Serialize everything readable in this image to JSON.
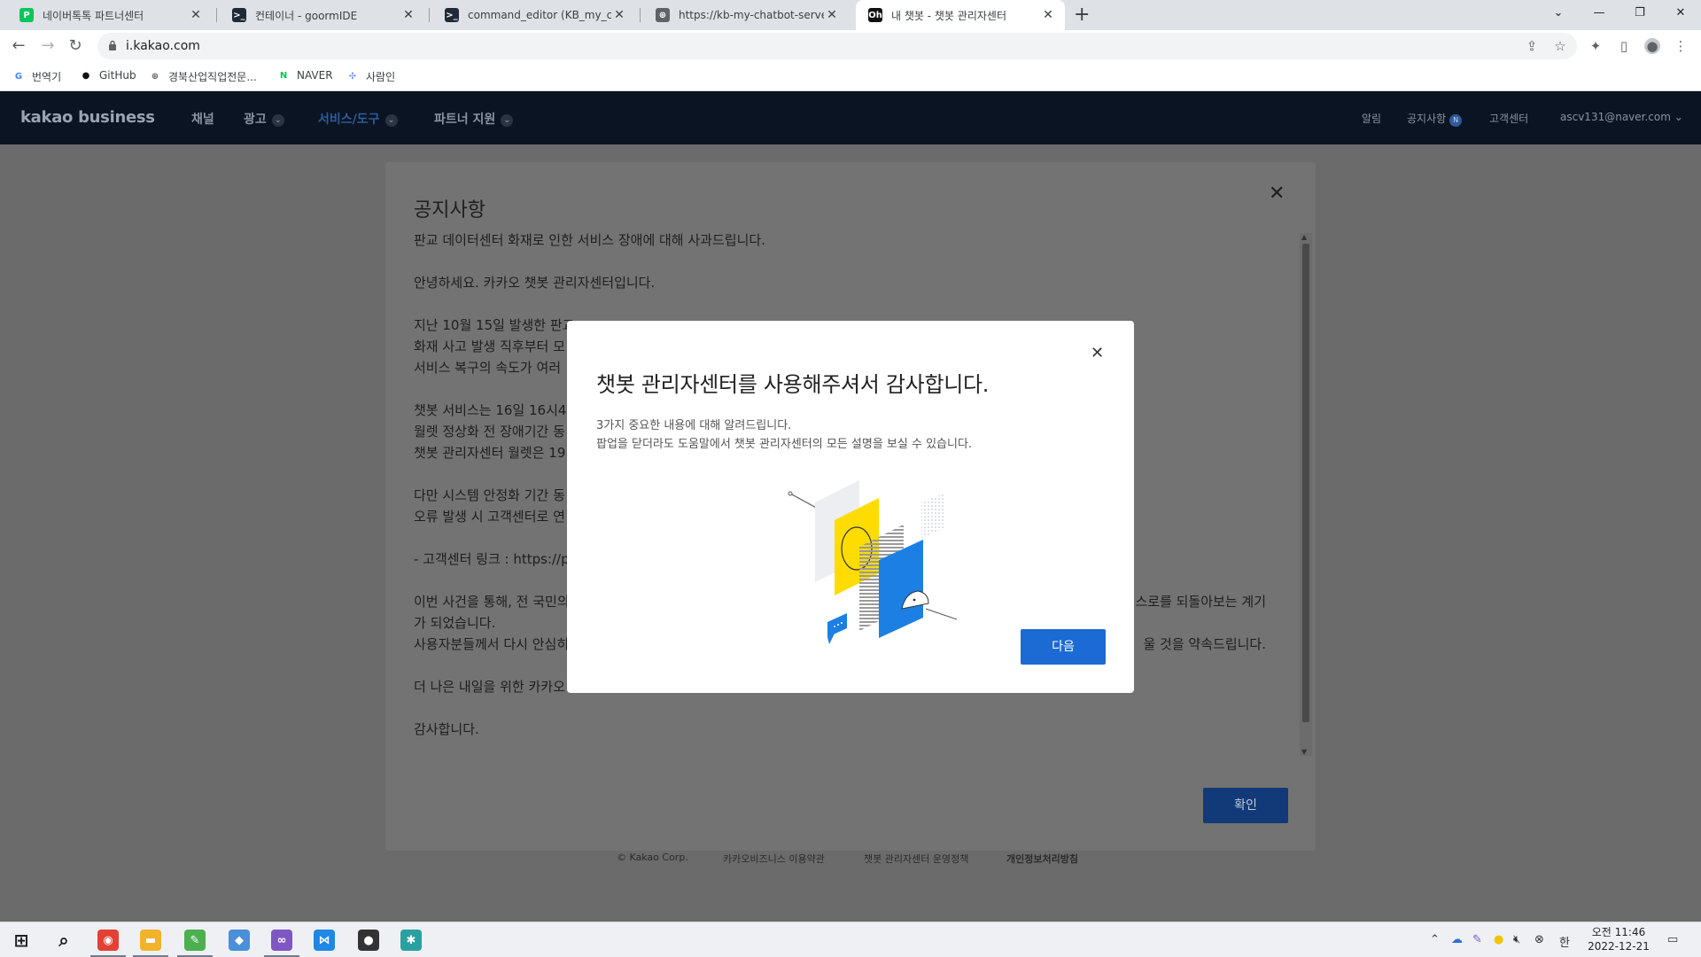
{
  "browser": {
    "tabs": [
      {
        "title": "네이버톡톡 파트너센터",
        "icon": "naver-talktalk-icon",
        "color": "#03c75a",
        "glyph": "P"
      },
      {
        "title": "컨테이너 - goormIDE",
        "icon": "terminal-icon",
        "color": "#1f2937",
        "glyph": ">_"
      },
      {
        "title": "command_editor (KB_my_chatbot...",
        "icon": "terminal-icon",
        "color": "#1f2937",
        "glyph": ">_"
      },
      {
        "title": "https://kb-my-chatbot-server-gu...",
        "icon": "globe-icon",
        "color": "#5f6368",
        "glyph": "⊕"
      },
      {
        "title": "내 챗봇 - 챗봇 관리자센터",
        "icon": "chatbot-icon",
        "color": "#111111",
        "glyph": "Oh"
      }
    ],
    "new_tab": "+",
    "window_controls": {
      "tab_search": "⌄",
      "minimize": "—",
      "restore": "❐",
      "close": "✕"
    },
    "url": "i.kakao.com",
    "bookmarks": [
      {
        "label": "번역기",
        "icon": "google-icon",
        "glyph": "G",
        "color": "#4285f4"
      },
      {
        "label": "GitHub",
        "icon": "github-icon",
        "glyph": "●",
        "color": "#111111"
      },
      {
        "label": "경북산업직업전문...",
        "icon": "globe-icon",
        "glyph": "⊕",
        "color": "#5f6368"
      },
      {
        "label": "NAVER",
        "icon": "naver-icon",
        "glyph": "N",
        "color": "#03c75a"
      },
      {
        "label": "사람인",
        "icon": "saramin-icon",
        "glyph": "✣",
        "color": "#6b8cff"
      }
    ]
  },
  "site": {
    "logo": "kakao business",
    "nav": [
      {
        "label": "채널",
        "has_menu": false,
        "active": false
      },
      {
        "label": "광고",
        "has_menu": true,
        "active": false
      },
      {
        "label": "서비스/도구",
        "has_menu": true,
        "active": true
      },
      {
        "label": "파트너 지원",
        "has_menu": true,
        "active": false
      }
    ],
    "util": {
      "alarm": "알림",
      "notice": "공지사항",
      "notice_badge": "N",
      "support": "고객센터",
      "account": "ascv131@naver.com ⌄"
    },
    "footer": {
      "copyright": "© Kakao Corp.",
      "terms": "카카오비즈니스 이용약관",
      "policy": "챗봇 관리자센터 운영정책",
      "privacy": "개인정보처리방침"
    }
  },
  "notice": {
    "title": "공지사항",
    "lines": [
      "판교 데이터센터 화재로 인한 서비스 장애에 대해 사과드립니다.",
      "",
      "안녕하세요. 카카오 챗봇 관리자센터입니다.",
      "",
      "지난 10월 15일 발생한 판교",
      "화재 사고 발생 직후부터 모",
      "서비스 복구의 속도가 여러",
      "",
      "챗봇 서비스는 16일 16시4",
      "월렛 정상화 전 장애기간 동",
      "챗봇 관리자센터 월렛은 19",
      "",
      "다만 시스템 안정화 기간 동",
      "오류 발생 시 고객센터로 연",
      "",
      "- 고객센터 링크 : https://p",
      "",
      "이번 사건을 통해, 전 국민의",
      "가 되었습니다.",
      "사용자분들께서 다시 안심히",
      "",
      "더 나은 내일을 위한 카카오",
      "",
      "감사합니다."
    ],
    "right_fragments": [
      {
        "line": 17,
        "text": "스로를 되돌아보는 계기"
      },
      {
        "line": 19,
        "text": "울 것을 약속드립니다."
      }
    ],
    "ok_label": "확인"
  },
  "dialog": {
    "title": "챗봇 관리자센터를 사용해주셔서 감사합니다.",
    "desc_1": "3가지 중요한 내용에 대해 알려드립니다.",
    "desc_2": "팝업을 닫더라도 도움말에서 챗봇 관리자센터의 모든 설명을 보실 수 있습니다.",
    "next_label": "다음",
    "colors": {
      "yellow": "#fedc00",
      "blue": "#1c7fe3",
      "gray": "#eceef2"
    }
  },
  "taskbar": {
    "apps": [
      {
        "name": "start-button",
        "glyph": "⊞",
        "color": "#1f1f1f",
        "open": false
      },
      {
        "name": "search-icon",
        "glyph": "⌕",
        "color": "#1f1f1f",
        "open": false
      },
      {
        "name": "chrome-icon",
        "glyph": "◉",
        "color": "#e34133",
        "open": true
      },
      {
        "name": "file-explorer-icon",
        "glyph": "▬",
        "color": "#f2b32a",
        "open": true
      },
      {
        "name": "notepad-icon",
        "glyph": "✎",
        "color": "#4caf50",
        "open": true
      },
      {
        "name": "app-icon",
        "glyph": "◆",
        "color": "#4a8fd8",
        "open": false
      },
      {
        "name": "visual-studio-icon",
        "glyph": "∞",
        "color": "#7e57c2",
        "open": true
      },
      {
        "name": "vscode-icon",
        "glyph": "⋈",
        "color": "#1e88e5",
        "open": false
      },
      {
        "name": "obs-icon",
        "glyph": "●",
        "color": "#333333",
        "open": false
      },
      {
        "name": "tool-icon",
        "glyph": "✱",
        "color": "#2aa1a1",
        "open": false
      }
    ],
    "tray_ime": "한",
    "clock_time": "오전 11:46",
    "clock_date": "2022-12-21"
  }
}
